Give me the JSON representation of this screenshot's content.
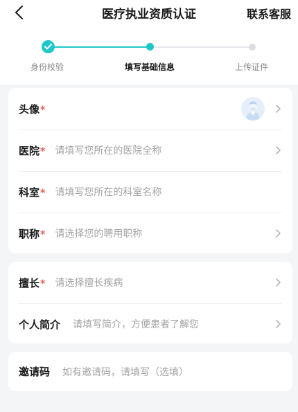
{
  "header": {
    "title": "医疗执业资质认证",
    "contact": "联系客服"
  },
  "steps": [
    {
      "label": "身份校验",
      "state": "done"
    },
    {
      "label": "填写基础信息",
      "state": "current"
    },
    {
      "label": "上传证件",
      "state": "pending"
    }
  ],
  "colors": {
    "accent": "#1fc7c9",
    "required": "#e8605c",
    "placeholder": "#a3a3a3"
  },
  "form": {
    "required_mark": "*",
    "avatar": {
      "label": "头像"
    },
    "hospital": {
      "label": "医院",
      "placeholder": "请填写您所在的医院全称"
    },
    "department": {
      "label": "科室",
      "placeholder": "请填写您所在的科室名称"
    },
    "title": {
      "label": "职称",
      "placeholder": "请选择您的聘用职称"
    },
    "specialty": {
      "label": "擅长",
      "placeholder": "请选择擅长疾病"
    },
    "intro": {
      "label": "个人简介",
      "placeholder": "请填写简介，方便患者了解您"
    },
    "invite": {
      "label": "邀请码",
      "placeholder": "如有邀请码，请填写（选填）"
    }
  }
}
